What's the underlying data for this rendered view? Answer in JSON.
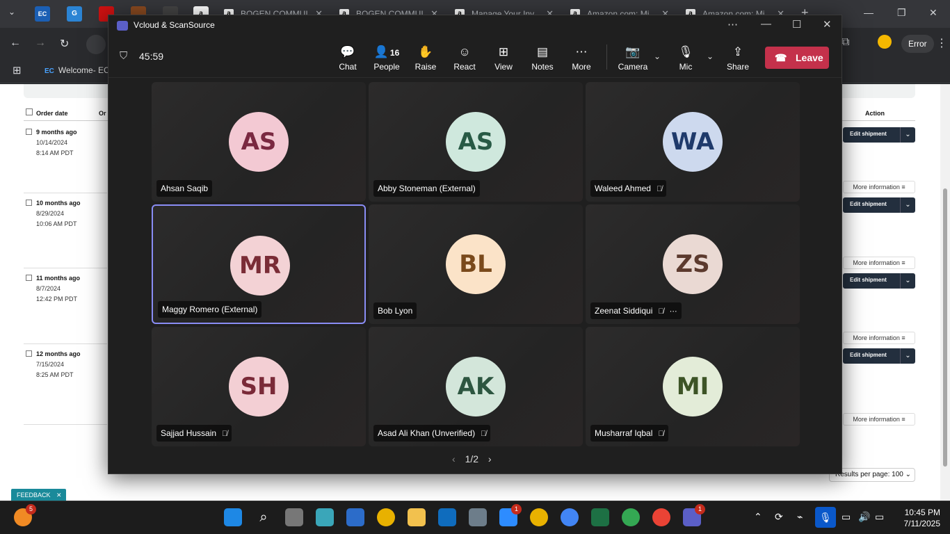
{
  "browser": {
    "tabs": [
      {
        "label": "BOGEN COMMUI",
        "favicon": "a"
      },
      {
        "label": "BOGEN COMMUI",
        "favicon": "a"
      },
      {
        "label": "Manage Your Inv",
        "favicon": "a"
      },
      {
        "label": "Amazon.com: Mi",
        "favicon": "a"
      },
      {
        "label": "Amazon.com: Mi",
        "favicon": "a"
      }
    ],
    "new_tab": "+",
    "profile_status": "Error",
    "bookmark": "Welcome- EC"
  },
  "page": {
    "header_order_date": "Order date",
    "header_order_col": "Or",
    "header_action": "Action",
    "orders": [
      {
        "ago": "9 months ago",
        "date": "10/14/2024",
        "time": "8:14 AM PDT"
      },
      {
        "ago": "10 months ago",
        "date": "8/29/2024",
        "time": "10:06 AM PDT"
      },
      {
        "ago": "11 months ago",
        "date": "8/7/2024",
        "time": "12:42 PM PDT"
      },
      {
        "ago": "12 months ago",
        "date": "7/15/2024",
        "time": "8:25 AM PDT"
      }
    ],
    "edit_shipment": "Edit shipment",
    "more_information": "More information",
    "results_per_page": "Results per page: 100",
    "feedback": "FEEDBACK"
  },
  "teams": {
    "window_title": "Vcloud & ScanSource",
    "timer": "45:59",
    "toolbar": {
      "chat": "Chat",
      "people": "People",
      "people_count": "16",
      "raise": "Raise",
      "react": "React",
      "view": "View",
      "notes": "Notes",
      "more": "More",
      "camera": "Camera",
      "mic": "Mic",
      "share": "Share",
      "leave": "Leave"
    },
    "participants": [
      {
        "initials": "AS",
        "name": "Ahsan Saqib",
        "muted": false,
        "bg": "#f3c9d3",
        "fg": "#7a2941"
      },
      {
        "initials": "AS",
        "name": "Abby Stoneman (External)",
        "muted": false,
        "bg": "#cfe8dd",
        "fg": "#285a45"
      },
      {
        "initials": "WA",
        "name": "Waleed Ahmed",
        "muted": true,
        "bg": "#cdd9ee",
        "fg": "#1f3a6b"
      },
      {
        "initials": "MR",
        "name": "Maggy Romero (External)",
        "muted": false,
        "bg": "#f3d2d5",
        "fg": "#7a2c36"
      },
      {
        "initials": "BL",
        "name": "Bob Lyon",
        "muted": false,
        "bg": "#fbe3c8",
        "fg": "#7a4a1c"
      },
      {
        "initials": "ZS",
        "name": "Zeenat Siddiqui",
        "muted": true,
        "bg": "#ead9d3",
        "fg": "#5c3a2e"
      },
      {
        "initials": "SH",
        "name": "Sajjad Hussain",
        "muted": true,
        "bg": "#f3cfd4",
        "fg": "#7a2a38"
      },
      {
        "initials": "AK",
        "name": "Asad Ali Khan (Unverified)",
        "muted": true,
        "bg": "#d3e6da",
        "fg": "#2d5640"
      },
      {
        "initials": "MI",
        "name": "Musharraf Iqbal",
        "muted": true,
        "bg": "#e3ecd8",
        "fg": "#3d5426"
      }
    ],
    "pager": "1/2"
  },
  "taskbar": {
    "weather_badge": "5",
    "zoom_badge": "1",
    "teams_badge": "1",
    "time": "10:45 PM",
    "date": "7/11/2025"
  }
}
